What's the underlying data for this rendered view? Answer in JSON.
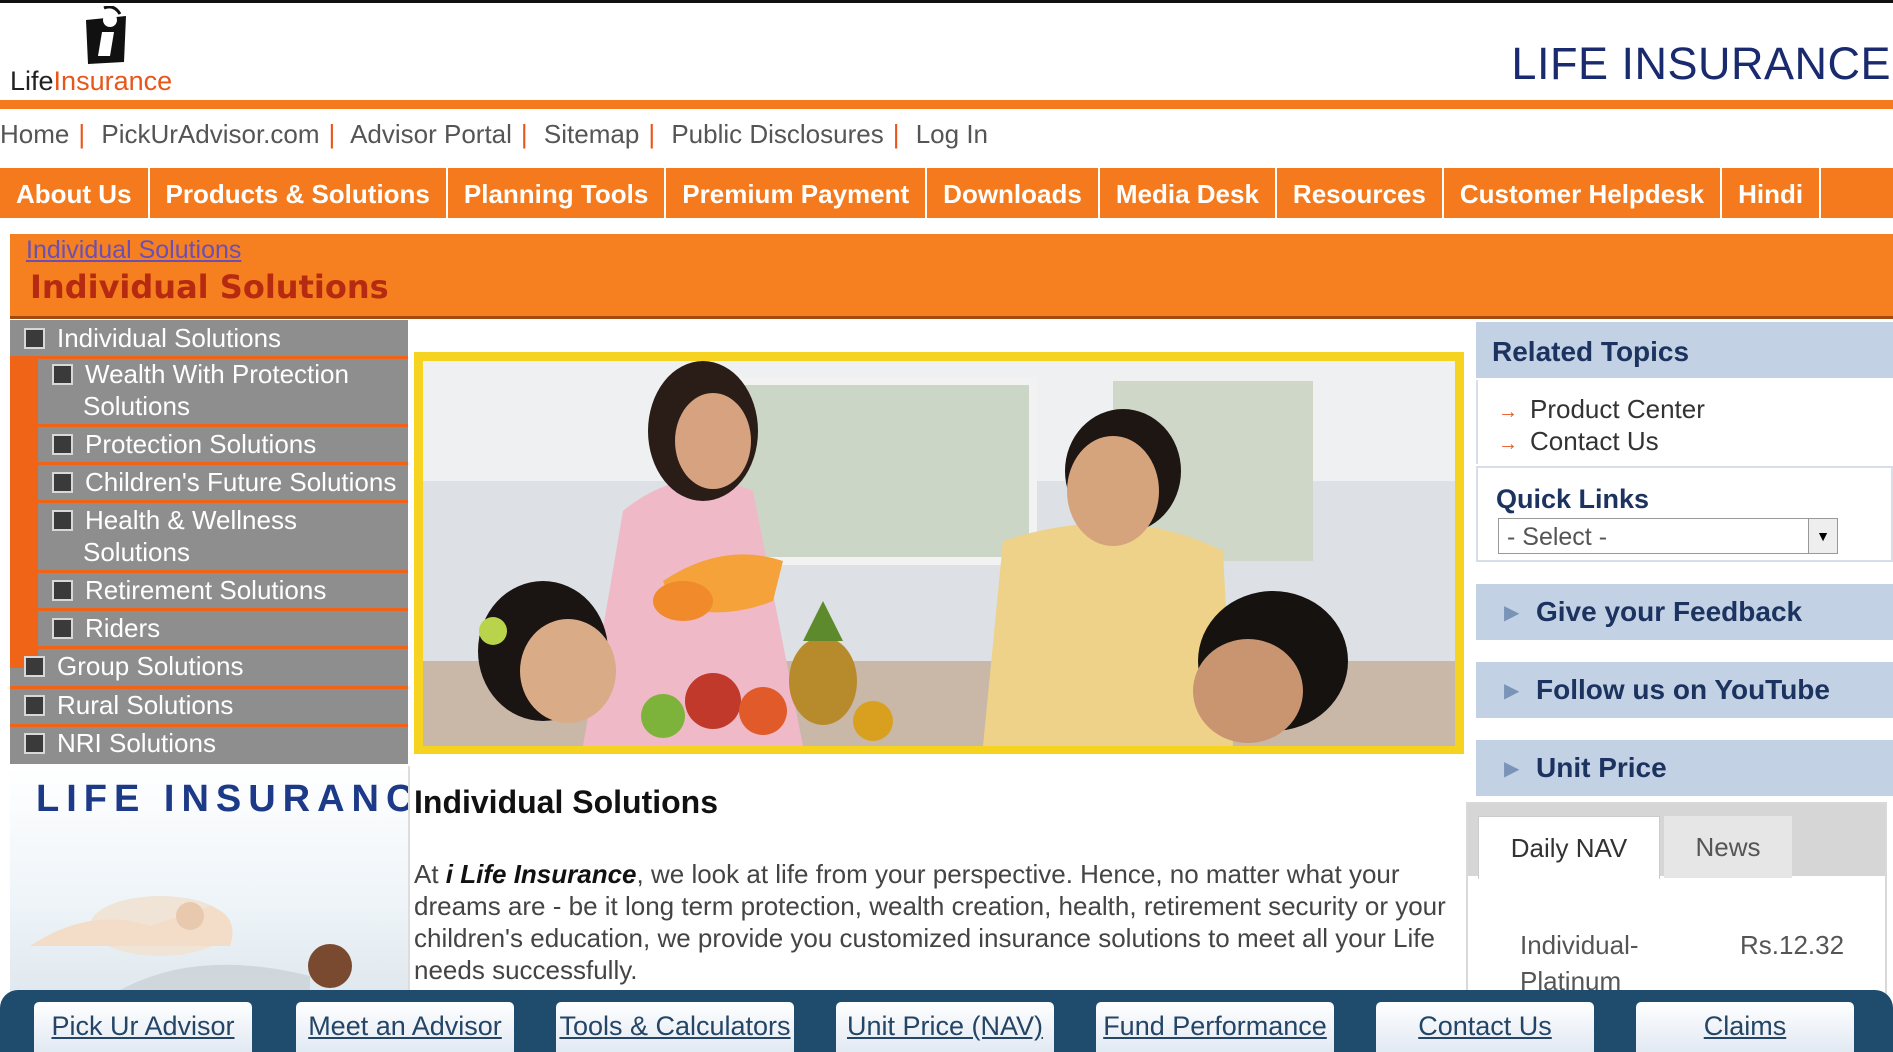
{
  "header": {
    "logo_text_a": "Life",
    "logo_text_b": "Insurance",
    "brand_title": "LIFE INSURANCE"
  },
  "util_links": [
    "Home",
    "PickUrAdvisor.com",
    "Advisor Portal",
    "Sitemap",
    "Public Disclosures",
    "Log In"
  ],
  "main_nav": [
    "About Us",
    "Products & Solutions",
    "Planning Tools",
    "Premium Payment",
    "Downloads",
    "Media Desk",
    "Resources",
    "Customer Helpdesk",
    "Hindi"
  ],
  "banner": {
    "breadcrumb": "Individual Solutions",
    "title": "Individual Solutions"
  },
  "left_nav": {
    "top": "Individual Solutions",
    "sub": [
      [
        "Wealth With Protection",
        "Solutions"
      ],
      [
        "Protection Solutions"
      ],
      [
        "Children's Future Solutions"
      ],
      [
        "Health & Wellness",
        "Solutions"
      ],
      [
        "Retirement Solutions"
      ],
      [
        "Riders"
      ]
    ],
    "others": [
      "Group Solutions",
      "Rural Solutions",
      "NRI Solutions"
    ]
  },
  "promo": {
    "title": "LIFE INSURANCE"
  },
  "content": {
    "title": "Individual Solutions",
    "body_pre": "At ",
    "body_brand": "i Life Insurance",
    "body_post": ", we look at life from your perspective.  Hence, no matter what your dreams are - be it long term protection, wealth creation, health, retirement security or your children's education, we provide you customized insurance solutions to meet all your Life needs successfully."
  },
  "right": {
    "related_title": "Related Topics",
    "related_links": [
      "Product Center",
      "Contact Us"
    ],
    "quick_title": "Quick Links",
    "quick_select": "- Select -",
    "bars": [
      "Give your Feedback",
      "Follow us on YouTube",
      "Unit Price"
    ]
  },
  "nav_widget": {
    "tabs": [
      "Daily NAV",
      "News"
    ],
    "fund_line1": "Individual-",
    "fund_line2": "Platinum",
    "fund_value": "Rs.12.32"
  },
  "bottom_bar": [
    "Pick Ur Advisor",
    "Meet an Advisor",
    "Tools & Calculators",
    "Unit Price (NAV)",
    "Fund Performance",
    "Contact Us",
    "Claims"
  ],
  "colors": {
    "orange": "#f47a1d",
    "navy": "#1c3360",
    "nav_blue": "#c2d1e4",
    "sidebar_gray": "#8e8e8e"
  }
}
